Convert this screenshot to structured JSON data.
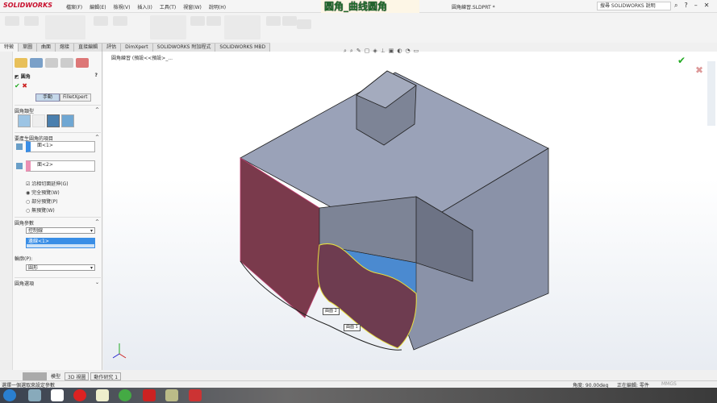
{
  "app": {
    "logo": "SOLIDWORKS",
    "menu": [
      "檔案(F)",
      "編輯(E)",
      "檢視(V)",
      "插入(I)",
      "工具(T)",
      "視窗(W)",
      "說明(H)"
    ],
    "overlay_title": "圆角_曲线圆角",
    "document": "圓角練習.SLDPRT *",
    "search_placeholder": "搜尋 SOLIDWORKS 說明"
  },
  "tabs": [
    "特徵",
    "草圖",
    "曲面",
    "熔接",
    "直接編輯",
    "評估",
    "DimXpert",
    "SOLIDWORKS 附加程式",
    "SOLIDWORKS MBD"
  ],
  "breadcrumb": "圓角練習 (預設<<預設>_...",
  "panel": {
    "title": "圓角",
    "mode_manual": "手動",
    "mode_xpert": "FilletXpert",
    "fillet_type": "圓角類型",
    "items_header": "要產生圓角的項目",
    "face1": "面<1>",
    "face2": "面<2>",
    "tangent": "沿相切面延伸(G)",
    "full_preview": "完全預覽(W)",
    "partial_preview": "部分預覽(P)",
    "no_preview": "無預覽(W)",
    "params_header": "圓角參數",
    "method": "控制線",
    "edge": "邊線<1>",
    "profile_label": "輪廓(P):",
    "profile": "圓形",
    "options_header": "圓角選項"
  },
  "callouts": {
    "s2": "曲面 2",
    "s1": "曲面 1"
  },
  "bottom_tabs": [
    "模型",
    "3D 視圖",
    "動作研究 1"
  ],
  "status": {
    "message": "選擇一個選取來設定參數",
    "angle": "角度: 90.00deg",
    "editing": "正在編輯: 零件",
    "units": "MMGS"
  }
}
